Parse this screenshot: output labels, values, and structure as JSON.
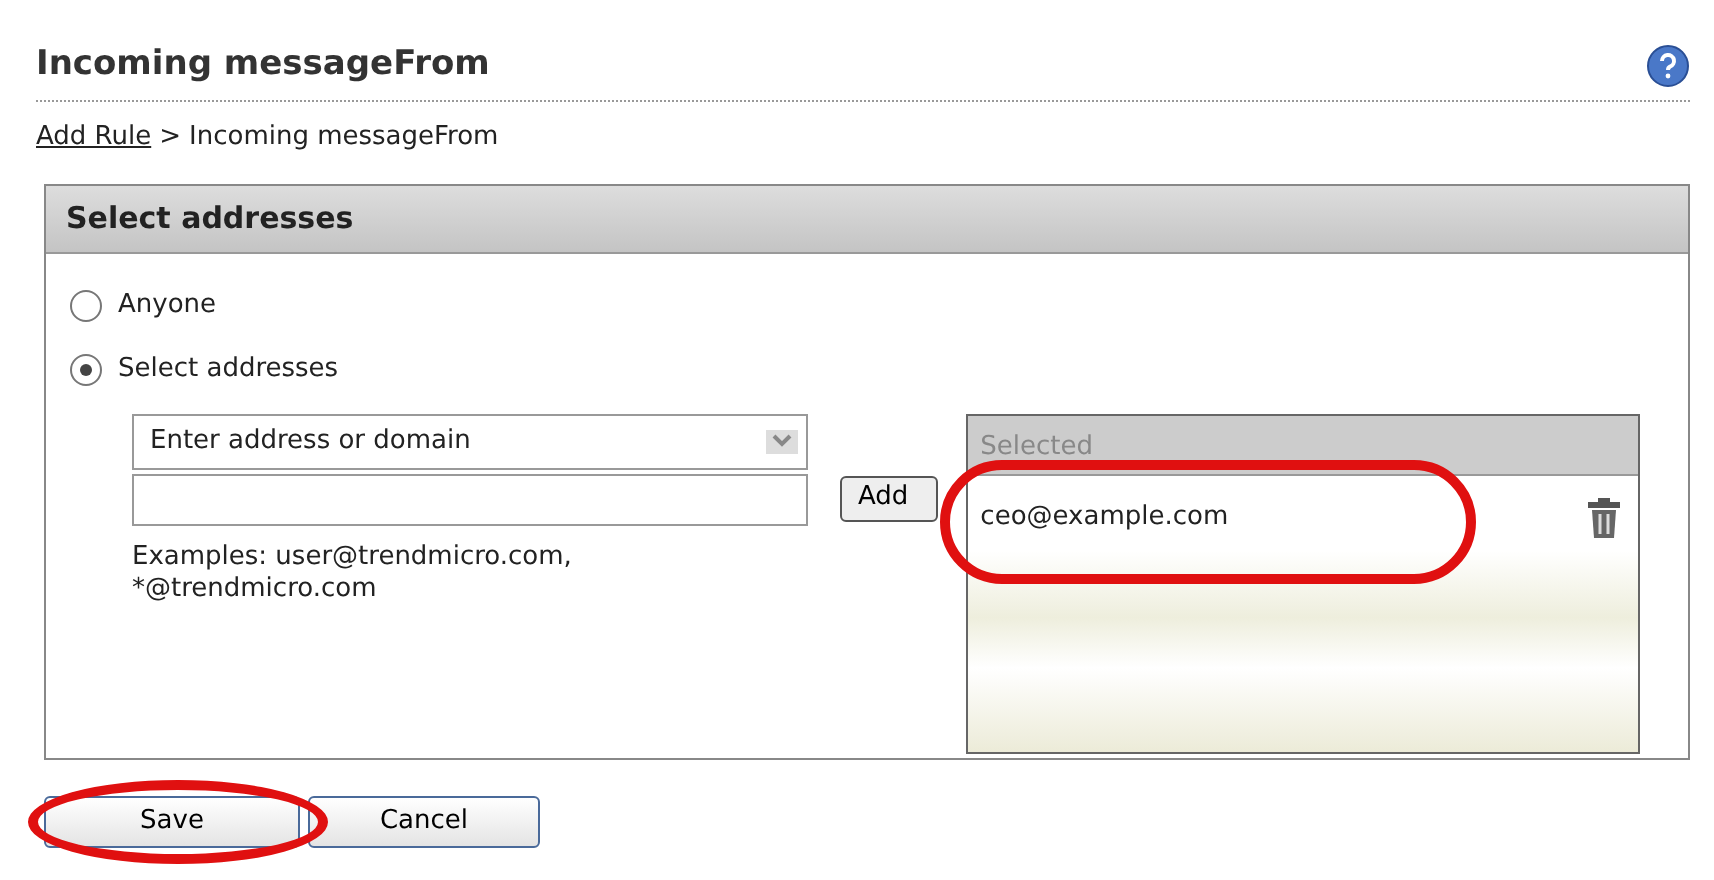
{
  "page": {
    "title": "Incoming messageFrom"
  },
  "breadcrumb": [
    {
      "label": "Add Rule",
      "kind": "link"
    },
    {
      "label": ">",
      "kind": "separator"
    },
    {
      "label": "Incoming messageFrom",
      "kind": "current"
    }
  ],
  "panel": {
    "title": "Select addresses",
    "options": [
      {
        "label": "Anyone",
        "selected": false
      },
      {
        "label": "Select addresses",
        "selected": true
      }
    ],
    "address_select": {
      "value": "Enter address or domain"
    },
    "examples": [
      "Examples: user@trendmicro.com,",
      "*@trendmicro.com"
    ],
    "add_button": "Add",
    "selected_list": {
      "header": "Selected",
      "items": [
        {
          "address": "ceo@example.com"
        }
      ]
    }
  },
  "buttons": [
    {
      "label": "Save",
      "highlighted": true
    },
    {
      "label": "Cancel",
      "highlighted": false
    }
  ]
}
